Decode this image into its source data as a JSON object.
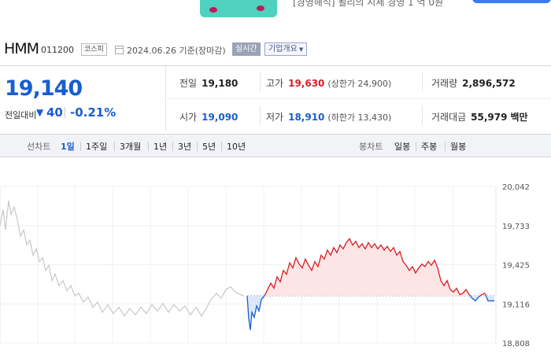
{
  "ad": {
    "text": "[경영해석] 될리의 시세 경영 1 억 0원"
  },
  "header": {
    "stock_name": "HMM",
    "stock_code": "011200",
    "market": "코스피",
    "date": "2024.06.26 기준(장마감)",
    "realtime_label": "실시간",
    "company_overview_label": "기업개요"
  },
  "price": {
    "current": "19,140",
    "change_label": "전일대비",
    "change_amount": "40",
    "change_percent": "-0.21%",
    "down_color": "#1a5dd0",
    "up_color": "#d81f26"
  },
  "stats": {
    "prev_close_label": "전일",
    "prev_close": "19,180",
    "high_label": "고가",
    "high": "19,630",
    "upper_limit": "(상한가 24,900)",
    "volume_label": "거래량",
    "volume": "2,896,572",
    "open_label": "시가",
    "open": "19,090",
    "low_label": "저가",
    "low": "18,910",
    "lower_limit": "(하한가 13,430)",
    "turnover_label": "거래대금",
    "turnover": "55,979",
    "turnover_unit": "백만"
  },
  "tabs": {
    "line_chart_label": "선차트",
    "line_periods": [
      "1일",
      "1주일",
      "3개월",
      "1년",
      "3년",
      "5년",
      "10년"
    ],
    "active_period": "1일",
    "candle_chart_label": "봉차트",
    "candle_periods": [
      "일봉",
      "주봉",
      "월봉"
    ]
  },
  "chart_data": {
    "type": "line",
    "title": "",
    "xlabel": "",
    "ylabel": "",
    "y_ticks": [
      "20,042",
      "19,733",
      "19,425",
      "19,116",
      "18,808"
    ],
    "ylim": [
      18808,
      20042
    ],
    "baseline_prev_close": 19180,
    "series": [
      {
        "points": [
          [
            0,
            19733
          ],
          [
            4,
            19860
          ],
          [
            7,
            19700
          ],
          [
            11,
            19930
          ],
          [
            14,
            19820
          ],
          [
            18,
            19880
          ],
          [
            22,
            19780
          ],
          [
            26,
            19650
          ],
          [
            30,
            19700
          ],
          [
            34,
            19580
          ],
          [
            38,
            19620
          ],
          [
            42,
            19500
          ],
          [
            46,
            19550
          ],
          [
            50,
            19450
          ],
          [
            54,
            19480
          ],
          [
            58,
            19380
          ],
          [
            62,
            19420
          ],
          [
            66,
            19300
          ],
          [
            70,
            19350
          ],
          [
            75,
            19260
          ],
          [
            80,
            19300
          ],
          [
            85,
            19220
          ],
          [
            90,
            19260
          ],
          [
            95,
            19180
          ],
          [
            100,
            19200
          ],
          [
            106,
            19130
          ],
          [
            112,
            19170
          ],
          [
            118,
            19090
          ],
          [
            124,
            19130
          ],
          [
            130,
            19050
          ],
          [
            137,
            19110
          ],
          [
            144,
            19040
          ],
          [
            151,
            19090
          ],
          [
            158,
            19020
          ],
          [
            165,
            19080
          ],
          [
            172,
            19030
          ],
          [
            179,
            19090
          ],
          [
            186,
            19040
          ],
          [
            193,
            19110
          ],
          [
            200,
            19060
          ],
          [
            207,
            19120
          ],
          [
            214,
            19050
          ],
          [
            221,
            19110
          ],
          [
            228,
            19060
          ],
          [
            235,
            19100
          ],
          [
            242,
            19030
          ],
          [
            249,
            19090
          ],
          [
            256,
            19020
          ],
          [
            262,
            19080
          ],
          [
            268,
            19150
          ],
          [
            275,
            19200
          ],
          [
            281,
            19160
          ],
          [
            287,
            19230
          ],
          [
            293,
            19250
          ],
          [
            299,
            19210
          ],
          [
            305,
            19190
          ],
          [
            310,
            19180
          ]
        ]
      },
      {
        "points": [
          [
            314,
            19180
          ],
          [
            316,
            19000
          ],
          [
            318,
            18910
          ],
          [
            320,
            19050
          ],
          [
            323,
            19010
          ],
          [
            326,
            19100
          ],
          [
            329,
            19060
          ],
          [
            332,
            19150
          ],
          [
            336,
            19180
          ],
          [
            340,
            19230
          ],
          [
            344,
            19280
          ],
          [
            348,
            19240
          ],
          [
            352,
            19330
          ],
          [
            356,
            19290
          ],
          [
            360,
            19380
          ],
          [
            364,
            19350
          ],
          [
            368,
            19440
          ],
          [
            372,
            19400
          ],
          [
            376,
            19480
          ],
          [
            380,
            19430
          ],
          [
            384,
            19400
          ],
          [
            388,
            19470
          ],
          [
            392,
            19420
          ],
          [
            396,
            19380
          ],
          [
            400,
            19450
          ],
          [
            404,
            19410
          ],
          [
            408,
            19500
          ],
          [
            412,
            19470
          ],
          [
            416,
            19540
          ],
          [
            420,
            19500
          ],
          [
            424,
            19560
          ],
          [
            428,
            19520
          ],
          [
            432,
            19580
          ],
          [
            436,
            19550
          ],
          [
            440,
            19600
          ],
          [
            444,
            19630
          ],
          [
            448,
            19580
          ],
          [
            452,
            19610
          ],
          [
            456,
            19560
          ],
          [
            460,
            19590
          ],
          [
            464,
            19550
          ],
          [
            468,
            19600
          ],
          [
            472,
            19560
          ],
          [
            476,
            19590
          ],
          [
            480,
            19550
          ],
          [
            484,
            19580
          ],
          [
            488,
            19540
          ],
          [
            492,
            19570
          ],
          [
            496,
            19530
          ],
          [
            500,
            19560
          ],
          [
            504,
            19500
          ],
          [
            508,
            19530
          ],
          [
            512,
            19450
          ],
          [
            516,
            19420
          ],
          [
            520,
            19380
          ],
          [
            524,
            19410
          ],
          [
            528,
            19360
          ],
          [
            532,
            19400
          ],
          [
            536,
            19430
          ],
          [
            540,
            19410
          ],
          [
            544,
            19450
          ],
          [
            548,
            19420
          ],
          [
            552,
            19460
          ],
          [
            556,
            19400
          ],
          [
            560,
            19300
          ],
          [
            564,
            19260
          ],
          [
            568,
            19300
          ],
          [
            572,
            19230
          ],
          [
            576,
            19210
          ],
          [
            580,
            19240
          ],
          [
            584,
            19190
          ],
          [
            588,
            19200
          ],
          [
            592,
            19230
          ],
          [
            596,
            19190
          ],
          [
            600,
            19160
          ],
          [
            604,
            19140
          ],
          [
            608,
            19170
          ],
          [
            612,
            19190
          ],
          [
            616,
            19200
          ],
          [
            620,
            19140
          ],
          [
            624,
            19140
          ],
          [
            628,
            19140
          ]
        ]
      }
    ]
  }
}
